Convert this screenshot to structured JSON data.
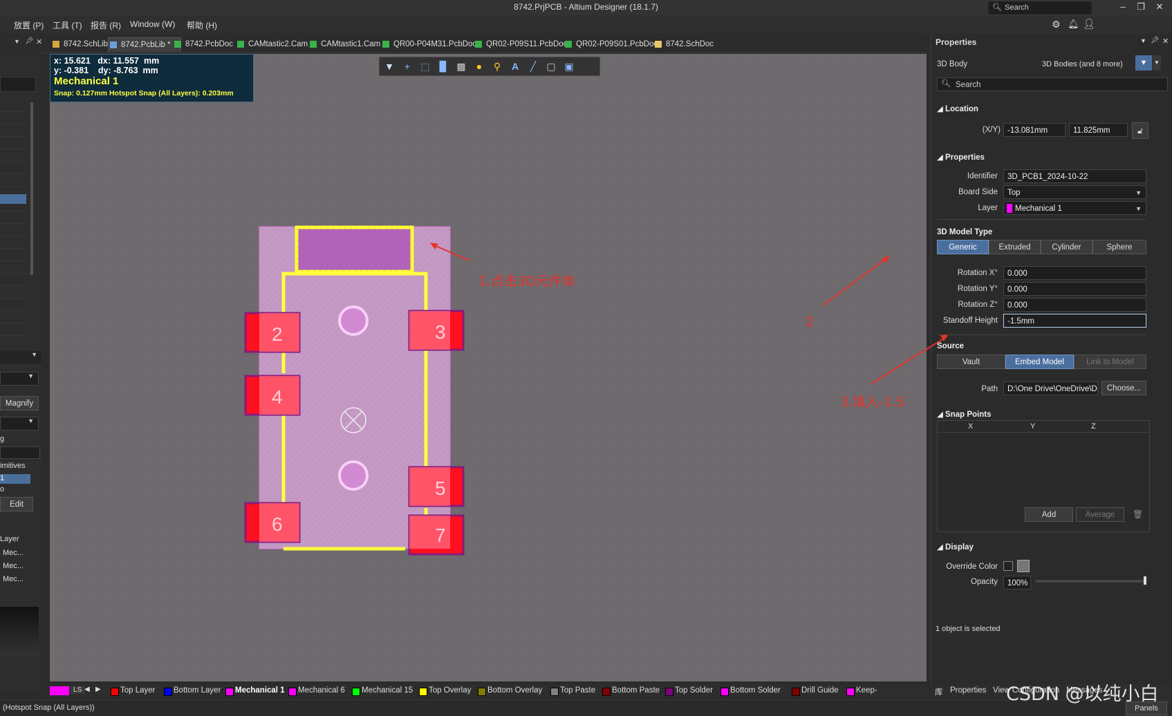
{
  "window": {
    "title": "8742.PrjPCB - Altium Designer (18.1.7)",
    "search_label": "Search",
    "minimize": "–",
    "restore": "❐",
    "close": "✕"
  },
  "menu": [
    "放置 (P)",
    "工具 (T)",
    "报告 (R)",
    "Window (W)",
    "帮助 (H)"
  ],
  "tabs": [
    {
      "label": "8742.SchLib",
      "color": "#d7a640",
      "active": false
    },
    {
      "label": "8742.PcbLib *",
      "color": "#6aa0d8",
      "active": true
    },
    {
      "label": "8742.PcbDoc",
      "color": "#38b24a",
      "active": false
    },
    {
      "label": "CAMtastic2.Cam",
      "color": "#38b24a",
      "active": false
    },
    {
      "label": "CAMtastic1.Cam",
      "color": "#38b24a",
      "active": false
    },
    {
      "label": "QR00-P04M31.PcbDoc",
      "color": "#38b24a",
      "active": false
    },
    {
      "label": "QR02-P09S11.PcbDoc",
      "color": "#38b24a",
      "active": false
    },
    {
      "label": "QR02-P09S01.PcbDoc",
      "color": "#38b24a",
      "active": false
    },
    {
      "label": "8742.SchDoc",
      "color": "#e6c76a",
      "active": false
    }
  ],
  "left_panel": {
    "magnify": "Magnify",
    "primitives": "imitives",
    "edit": "Edit",
    "layer_header": "Layer",
    "layers": [
      "Mec...",
      "Mec...",
      "Mec..."
    ],
    "short_g": "g",
    "short_1": "1",
    "short_o": "o"
  },
  "hud": {
    "line1": "x: 15.621   dx: 11.557  mm",
    "line2": "y: -0.381    dy: -8.763  mm",
    "layer": "Mechanical 1",
    "snap": "Snap: 0.127mm Hotspot Snap (All Layers): 0.203mm"
  },
  "toolbar_icons": [
    "filter-icon",
    "add-icon",
    "select-rect-icon",
    "align-icon",
    "component-icon",
    "pad-icon",
    "via-icon",
    "text-icon",
    "line-icon",
    "region-icon",
    "board-icon"
  ],
  "footprint": {
    "pads": [
      "2",
      "3",
      "4",
      "5",
      "6",
      "7"
    ]
  },
  "annotations": {
    "a1": "1.点击3D元件体",
    "a2": "2",
    "a3": "3.填入-1.5"
  },
  "properties_panel": {
    "title": "Properties",
    "object_type": "3D Body",
    "filter_text": "3D Bodies (and 8 more)",
    "search_placeholder": "Search",
    "location": {
      "header": "Location",
      "xy_label": "(X/Y)",
      "x": "-13.081mm",
      "y": "11.825mm"
    },
    "properties": {
      "header": "Properties",
      "identifier_label": "Identifier",
      "identifier": "3D_PCB1_2024-10-22",
      "board_side_label": "Board Side",
      "board_side": "Top",
      "layer_label": "Layer",
      "layer": "Mechanical 1",
      "layer_color": "#ff00ff"
    },
    "model_type": {
      "header": "3D Model Type",
      "options": [
        "Generic",
        "Extruded",
        "Cylinder",
        "Sphere"
      ],
      "selected": "Generic",
      "rot_x_label": "Rotation X°",
      "rot_x": "0.000",
      "rot_y_label": "Rotation Y°",
      "rot_y": "0.000",
      "rot_z_label": "Rotation Z°",
      "rot_z": "0.000",
      "standoff_label": "Standoff Height",
      "standoff": "-1.5mm"
    },
    "source": {
      "header": "Source",
      "options": [
        "Vault",
        "Embed Model",
        "Link to Model"
      ],
      "selected": "Embed Model",
      "path_label": "Path",
      "path": "D:\\One Drive\\OneDrive\\Des",
      "choose": "Choose..."
    },
    "snap_points": {
      "header": "Snap Points",
      "columns": [
        "X",
        "Y",
        "Z"
      ],
      "add": "Add",
      "average": "Average"
    },
    "display": {
      "header": "Display",
      "override_label": "Override Color",
      "opacity_label": "Opacity",
      "opacity": "100%"
    },
    "selection_status": "1 object is selected"
  },
  "layer_tabs": [
    {
      "label": "Top Layer",
      "color": "#ff0000",
      "active": false
    },
    {
      "label": "Bottom Layer",
      "color": "#0000ff",
      "active": false
    },
    {
      "label": "Mechanical 1",
      "color": "#ff00ff",
      "active": true
    },
    {
      "label": "Mechanical 6",
      "color": "#ff00ff",
      "active": false
    },
    {
      "label": "Mechanical 15",
      "color": "#00ff00",
      "active": false
    },
    {
      "label": "Top Overlay",
      "color": "#ffff00",
      "active": false
    },
    {
      "label": "Bottom Overlay",
      "color": "#808000",
      "active": false
    },
    {
      "label": "Top Paste",
      "color": "#808080",
      "active": false
    },
    {
      "label": "Bottom Paste",
      "color": "#800000",
      "active": false
    },
    {
      "label": "Top Solder",
      "color": "#800080",
      "active": false
    },
    {
      "label": "Bottom Solder",
      "color": "#ff00ff",
      "active": false
    },
    {
      "label": "Drill Guide",
      "color": "#800000",
      "active": false
    },
    {
      "label": "Keep-",
      "color": "#ff00ff",
      "active": false
    }
  ],
  "layer_set": "LS",
  "status": {
    "left": "(Hotspot Snap (All Layers))",
    "properties_tab": "Properties",
    "view_config": "View Configuration",
    "messages": "Messages",
    "lib_char": "库",
    "watermark": "CSDN @以纯小白",
    "panels": "Panels"
  }
}
